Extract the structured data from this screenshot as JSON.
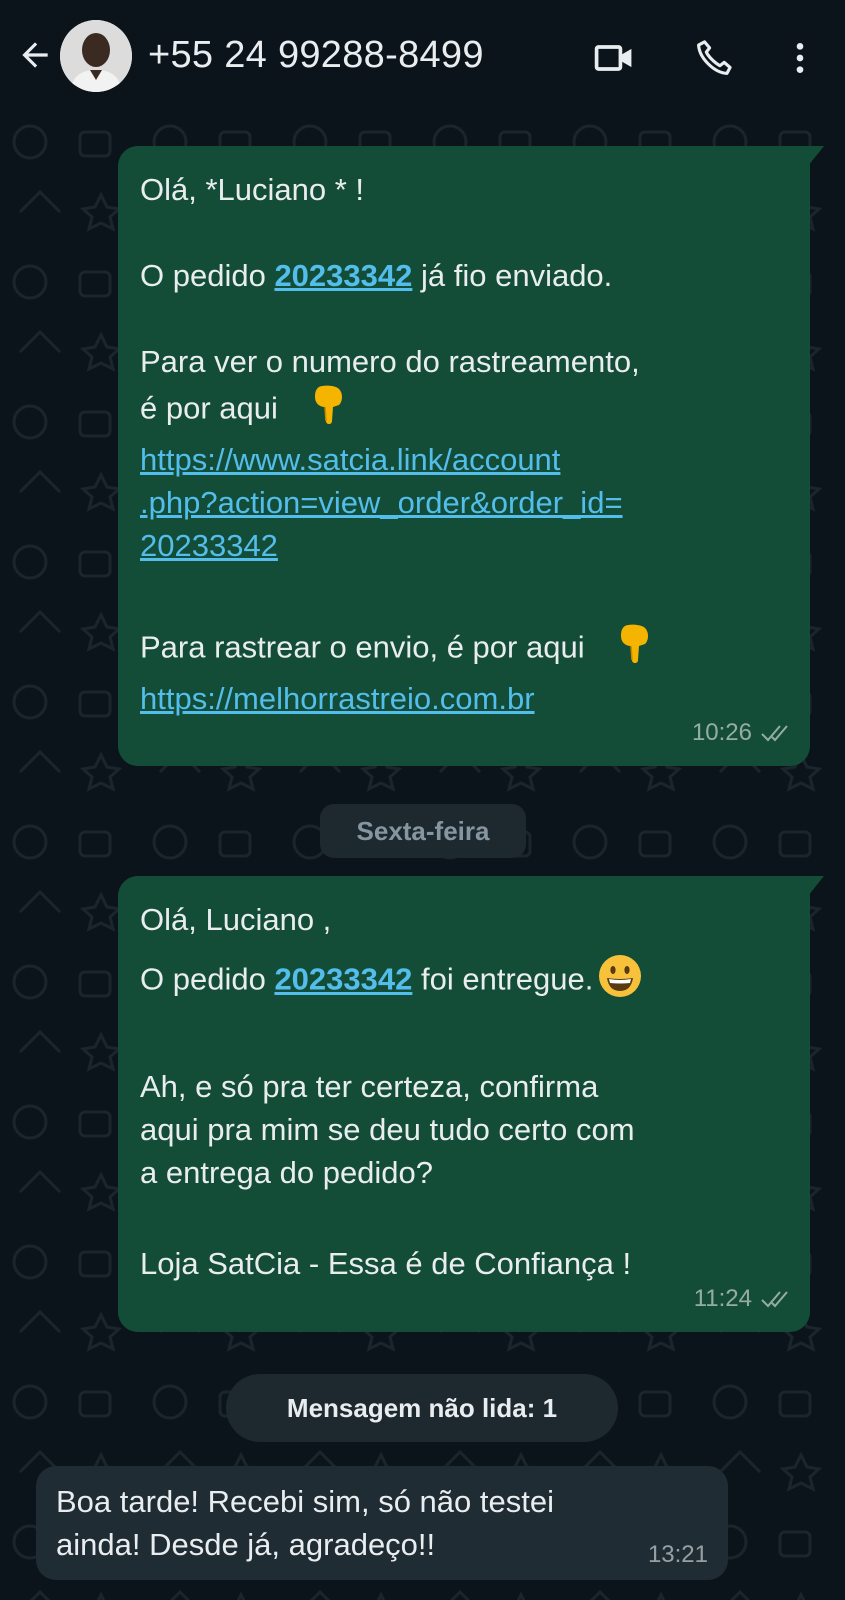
{
  "header": {
    "contact_name": "+55 24 99288-8499",
    "icons": [
      "back-arrow-icon",
      "video-call-icon",
      "phone-icon",
      "more-vert-icon"
    ]
  },
  "messages": {
    "msg1": {
      "greeting": "Olá, *Luciano * !",
      "order_prefix": "O pedido ",
      "order_number": "20233342",
      "order_suffix": " já fio enviado.",
      "tracking_line1": "Para ver o numero do rastreamento,",
      "tracking_line2": "é por aqui",
      "link1_part1": "https://www.satcia.link/account",
      "link1_part2": ".php?action=view_order&order_id=",
      "link1_part3": "20233342",
      "ship_line": "Para rastrear o envio, é por aqui",
      "link2": "https://melhorrastreio.com.br",
      "time": "10:26"
    },
    "date_separator": "Sexta-feira",
    "msg2": {
      "greeting": "Olá, Luciano ,",
      "order_prefix": "O pedido ",
      "order_number": "20233342",
      "order_suffix": " foi entregue.",
      "line3": "Ah, e só pra ter certeza, confirma",
      "line4": "aqui pra mim se deu tudo certo com",
      "line5": "a entrega do pedido?",
      "line6": "Loja SatCia - Essa é de Confiança !",
      "time": "11:24"
    },
    "unread_label": "Mensagem não lida: 1",
    "msg3": {
      "line1": "Boa tarde! Recebi sim,  só  não testei",
      "line2": "ainda! Desde já,  agradeço!!",
      "time": "13:21"
    }
  },
  "colors": {
    "background": "#0b141a",
    "outgoing_bubble": "#144d37",
    "incoming_bubble": "#202c33",
    "link": "#53bdeb",
    "pill": "#1d282f"
  }
}
